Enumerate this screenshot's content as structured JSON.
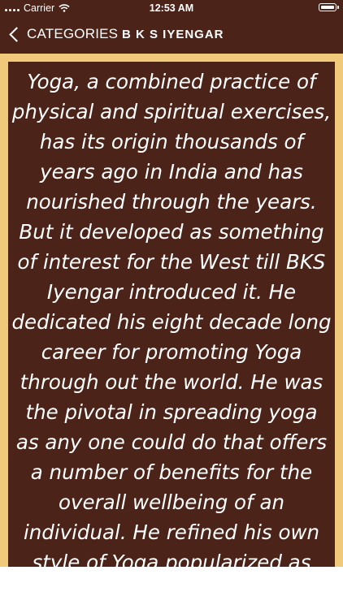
{
  "status_bar": {
    "carrier": "Carrier",
    "time": "12:53 AM",
    "battery_level": 1.0
  },
  "nav": {
    "back_label": "CATEGORIES",
    "title": "B K S IYENGAR"
  },
  "content": {
    "text": "Yoga, a combined practice of physical and spiritual exercises, has its origin thousands of years ago in India and has nourished through the years. But it developed as something of interest for the West till BKS Iyengar introduced it. He dedicated his eight decade long career for promoting Yoga through out the world. He was the pivotal in spreading yoga as any one could do that offers a number of benefits for the overall wellbeing of an individual. He refined his own style of Yoga popularized as"
  },
  "colors": {
    "header_bg": "#4b2319",
    "card_bg": "#4b2319",
    "frame_border": "#f1c97a",
    "text": "#ffffff"
  },
  "icons": [
    "signal-icon",
    "wifi-icon",
    "battery-icon",
    "chevron-left-icon"
  ]
}
